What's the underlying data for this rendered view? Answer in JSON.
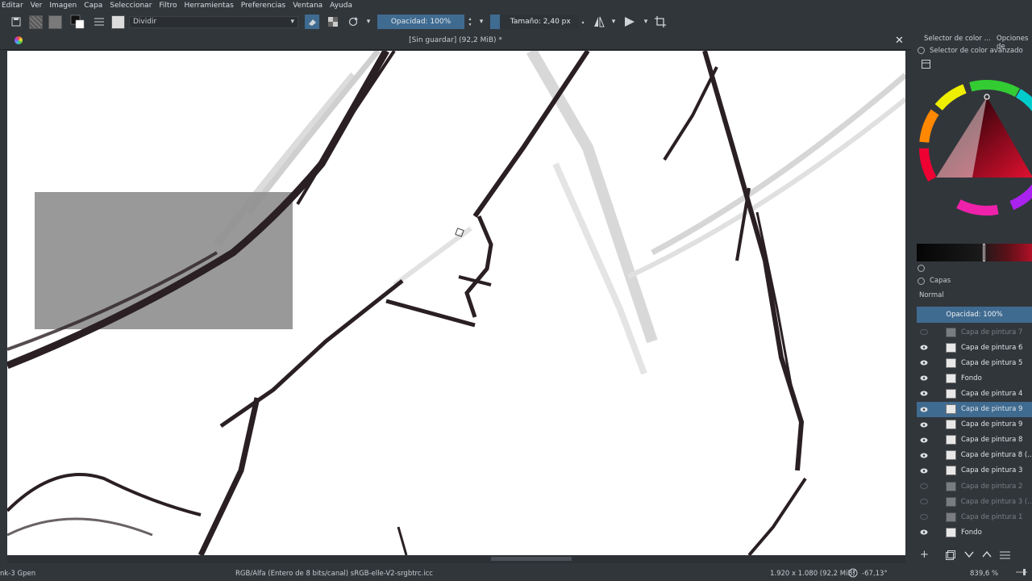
{
  "menu": [
    "Editar",
    "Ver",
    "Imagen",
    "Capa",
    "Seleccionar",
    "Filtro",
    "Herramientas",
    "Preferencias",
    "Ventana",
    "Ayuda"
  ],
  "toolbar": {
    "blend_mode": "Dividir",
    "opacity_label": "Opacidad: 100%",
    "size_label": "Tamaño: 2,40 px"
  },
  "document": {
    "title": "[Sin guardar]  (92,2 MiB) *"
  },
  "dock": {
    "tab_color": "Selector de color ...",
    "tab_options": "Opciones de",
    "color_panel_title": "Selector de color avanzado",
    "layers_title": "Capas",
    "blend_mode": "Normal",
    "opacity": "Opacidad:  100%"
  },
  "layers": [
    {
      "name": "Capa de pintura 7",
      "visible": false,
      "active": false
    },
    {
      "name": "Capa de pintura 6",
      "visible": true,
      "active": false
    },
    {
      "name": "Capa de pintura 5",
      "visible": true,
      "active": false
    },
    {
      "name": "Fondo",
      "visible": true,
      "active": false
    },
    {
      "name": "Capa de pintura 4",
      "visible": true,
      "active": false
    },
    {
      "name": "Capa de pintura 9",
      "visible": true,
      "active": true
    },
    {
      "name": "Capa de pintura 9",
      "visible": true,
      "active": false
    },
    {
      "name": "Capa de pintura 8",
      "visible": true,
      "active": false
    },
    {
      "name": "Capa de pintura 8 (...",
      "visible": true,
      "active": false
    },
    {
      "name": "Capa de pintura 3",
      "visible": true,
      "active": false
    },
    {
      "name": "Capa de pintura 2",
      "visible": false,
      "active": false
    },
    {
      "name": "Capa de pintura 3 (...",
      "visible": false,
      "active": false
    },
    {
      "name": "Capa de pintura 1",
      "visible": false,
      "active": false
    },
    {
      "name": "Fondo",
      "visible": true,
      "active": false
    }
  ],
  "status": {
    "brush": "nk-3 Gpen",
    "color_space": "RGB/Alfa (Entero de 8 bits/canal)  sRGB-elle-V2-srgbtrc.icc",
    "dimensions": "1.920 x 1.080 (92,2 MiB)",
    "rotation": "-67,13°",
    "zoom": "839,6 %"
  },
  "colors": {
    "accent": "#3f6b91",
    "bg": "#31363b",
    "ink": "#2a1f22"
  }
}
